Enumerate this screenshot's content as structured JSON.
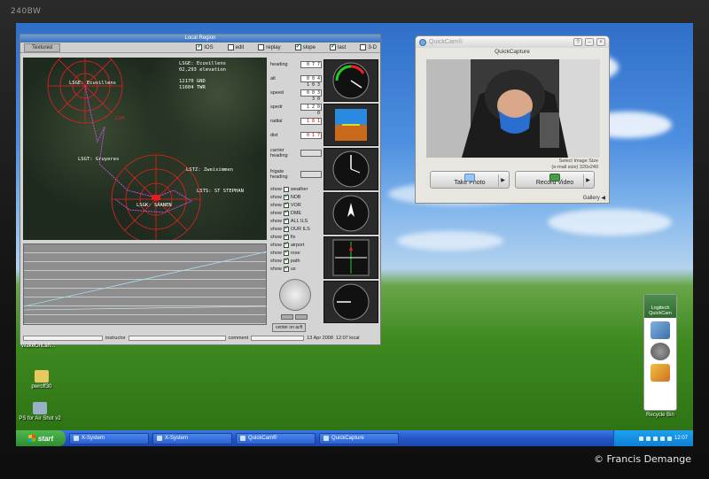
{
  "bezel": {
    "brand": "240BW",
    "copyright": "© Francis Demange"
  },
  "sim": {
    "title": "Local Region",
    "tab": "Textured",
    "checks": [
      {
        "label": "IOS",
        "on": true
      },
      {
        "label": "edit",
        "on": false
      },
      {
        "label": "replay",
        "on": false
      },
      {
        "label": "slope",
        "on": true
      },
      {
        "label": "last",
        "on": true
      },
      {
        "label": "3-D",
        "on": false
      }
    ],
    "map_labels": {
      "ecuvillens": "LSGE: Ecuvillens",
      "gruyeres": "LSGT: Gruyeres",
      "saanen": "LSGK: SAANEN",
      "zweisimmen": "LSTZ: Zweisimmen",
      "stephan": "LSTS: ST STEPHAN",
      "info1": "LSGE: Ecuvillens",
      "info2": "02,293 elevation",
      "info3": "12170 GND",
      "info4": "11604 TWR",
      "lsh": "LSH"
    },
    "panel": {
      "heading_label": "heading",
      "heading_val": "0 7 7",
      "alt_label": "alt",
      "alt_val": "0 0 4 1 0 3",
      "speed_label": "speed",
      "speed_val": "0 0 3 3 0",
      "spedr_label": "spedr",
      "spedr_val": "1 2 0 0",
      "radial_label": "radial",
      "radial_val": "1 8 1",
      "dist_label": "dist",
      "dist_val": "0 1 7",
      "carrier_label": "carrier heading",
      "frigate_label": "frigate heading"
    },
    "shows": [
      {
        "label": "weather",
        "on": false
      },
      {
        "label": "NDB",
        "on": true
      },
      {
        "label": "VOR",
        "on": true
      },
      {
        "label": "DME",
        "on": true
      },
      {
        "label": "ALL ILS",
        "on": true
      },
      {
        "label": "OUR ILS",
        "on": true
      },
      {
        "label": "fix",
        "on": true
      },
      {
        "label": "airport",
        "on": true
      },
      {
        "label": "rose",
        "on": true
      },
      {
        "label": "path",
        "on": true
      },
      {
        "label": "us",
        "on": true
      }
    ],
    "show_word": "show",
    "center_button": "center on acft",
    "status": {
      "instructor": "instructor",
      "comment": "comment",
      "date": "13 Apr 2008",
      "time": "12:07 local"
    }
  },
  "quickcam": {
    "title": "QuickCam®",
    "subtitle": "QuickCapture",
    "size_info_1": "Select Image Size",
    "size_info_2": "(e-mail size) 320x240",
    "take_photo": "Take Photo",
    "record_video": "Record Video",
    "gallery": "Gallery"
  },
  "logitech": {
    "title": "Logitech QuickCam"
  },
  "desktop": {
    "icons": [
      {
        "label": "WakeOnLan..."
      },
      {
        "label": "pwroff30"
      },
      {
        "label": "PS for Air Shot v2"
      },
      {
        "label": "Recycle Bin"
      }
    ]
  },
  "taskbar": {
    "start": "start",
    "tasks": [
      "X-System",
      "X-System",
      "QuickCam®",
      "QuickCapture"
    ],
    "clock": "12:07"
  },
  "colors": {
    "taskbar": "#2456c8",
    "start": "#2f8c2f",
    "accent_red": "#e02020"
  }
}
